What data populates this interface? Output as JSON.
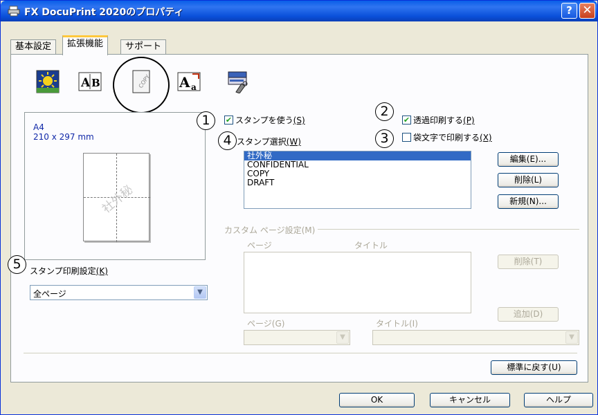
{
  "window": {
    "title": "FX DocuPrint 2020のプロパティ",
    "help_label": "?",
    "close_label": "✕"
  },
  "tabs": [
    {
      "label": "基本設定",
      "active": false
    },
    {
      "label": "拡張機能",
      "active": true
    },
    {
      "label": "サポート",
      "active": false
    }
  ],
  "toolbar": {
    "icons": [
      "watermark-sun-icon",
      "a-b-layout-icon",
      "copy-stamp-icon",
      "font-substitution-icon",
      "printer-settings-icon"
    ]
  },
  "preview": {
    "paper": "A4",
    "dimensions": "210 x 297 mm",
    "stamp_text": "社外秘"
  },
  "callouts": [
    "1",
    "2",
    "3",
    "4",
    "5"
  ],
  "stamp": {
    "use_stamp": {
      "label": "スタンプを使う",
      "key": "(S)",
      "checked": true
    },
    "transparent": {
      "label": "透過印刷する",
      "key": "(P)",
      "checked": true
    },
    "outline": {
      "label": "袋文字で印刷する",
      "key": "(X)",
      "checked": false
    },
    "select_label": "スタンプ選択",
    "select_key": "(W)",
    "items": [
      "社外秘",
      "CONFIDENTIAL",
      "COPY",
      "DRAFT"
    ],
    "selected_index": 0,
    "buttons": {
      "edit": "編集(E)...",
      "delete": "削除(L)",
      "new": "新規(N)..."
    }
  },
  "custom_page": {
    "group_label": "カスタム ページ設定(M)",
    "col_page": "ページ",
    "col_title": "タイトル",
    "delete_button": "削除(T)",
    "add_button": "追加(D)",
    "page_field_label": "ページ(G)",
    "title_field_label": "タイトル(I)"
  },
  "print_setting": {
    "label": "スタンプ印刷設定",
    "key": "(K)",
    "value": "全ページ"
  },
  "footer": {
    "reset_button": "標準に戻す(U)",
    "ok": "OK",
    "cancel": "キャンセル",
    "help": "ヘルプ"
  },
  "colors": {
    "titlebar": "#0a5ee8",
    "selection": "#316ac5",
    "tab_highlight": "#ffc83c",
    "preview_text": "#1028a8"
  }
}
